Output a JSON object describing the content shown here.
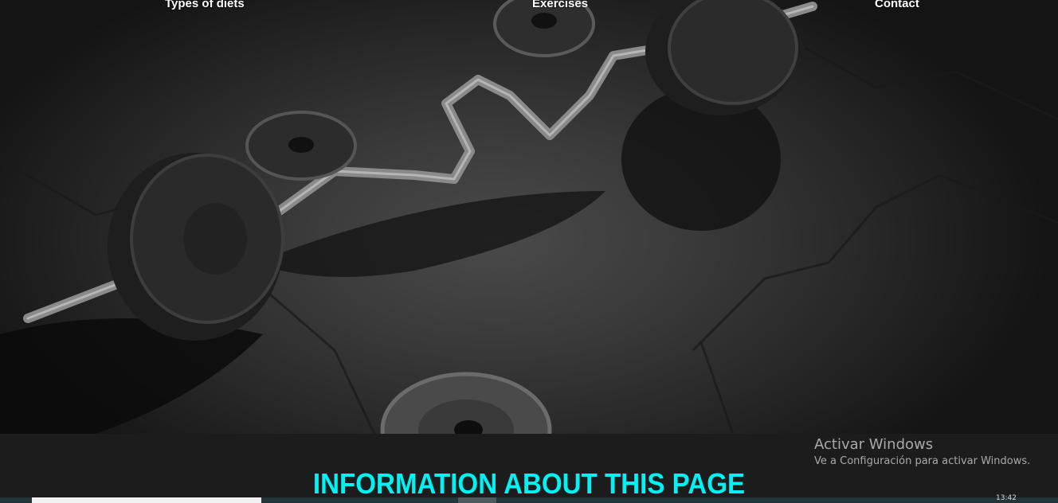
{
  "nav": {
    "item1": "Types of diets",
    "item2": "Exercises",
    "item3": "Contact"
  },
  "info": {
    "title": "INFORMATION ABOUT THIS PAGE"
  },
  "watermark": {
    "title": "Activar Windows",
    "subtitle": "Ve a Configuración para activar Windows."
  },
  "taskbar": {
    "clock": "13:42"
  },
  "colors": {
    "accent": "#00f2f2",
    "band": "#1c1c1c"
  }
}
